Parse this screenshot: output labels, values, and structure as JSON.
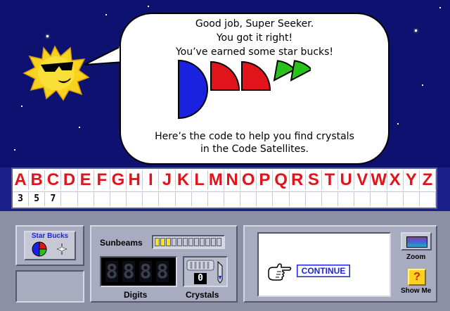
{
  "message": {
    "line1": "Good job, Super Seeker.",
    "line2": "You got it right!",
    "line3": "You’ve earned some star bucks!",
    "line4": "Here’s the code to help you find crystals",
    "line5": "in the Code Satellites."
  },
  "code": {
    "letters": [
      "A",
      "B",
      "C",
      "D",
      "E",
      "F",
      "G",
      "H",
      "I",
      "J",
      "K",
      "L",
      "M",
      "N",
      "O",
      "P",
      "Q",
      "R",
      "S",
      "T",
      "U",
      "V",
      "W",
      "X",
      "Y",
      "Z"
    ],
    "digits": [
      "3",
      "5",
      "7",
      "",
      "",
      "",
      "",
      "",
      "",
      "",
      "",
      "",
      "",
      "",
      "",
      "",
      "",
      "",
      "",
      "",
      "",
      "",
      "",
      "",
      "",
      ""
    ]
  },
  "panel": {
    "star_bucks_label": "Star Bucks",
    "sunbeams_label": "Sunbeams",
    "sunbeams_filled": 3,
    "sunbeams_total": 12,
    "digits_label": "Digits",
    "crystals_label": "Crystals",
    "crystals_count": "0",
    "continue_label": "CONTINUE",
    "zoom_label": "Zoom",
    "show_me_label": "Show Me",
    "show_me_glyph": "?"
  },
  "colors": {
    "accent_red": "#e0141a",
    "blue": "#1a22e0",
    "green": "#28c21a",
    "space": "#0d1270"
  }
}
